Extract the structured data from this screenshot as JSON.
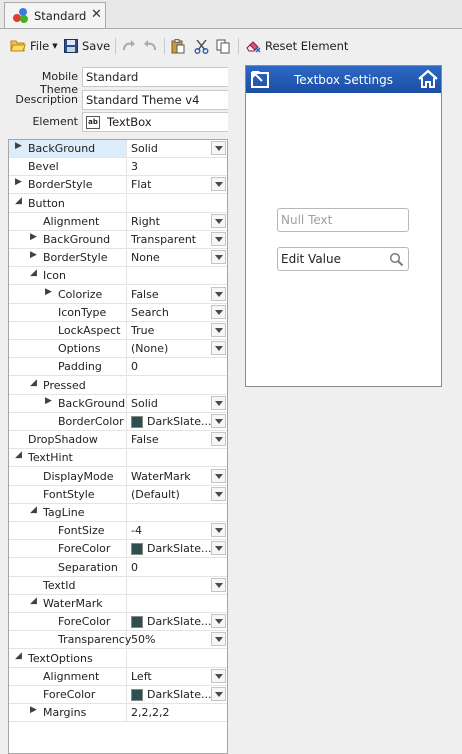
{
  "tab": {
    "title": "Standard",
    "close": "✕"
  },
  "toolbar": {
    "file_label": "File",
    "save_label": "Save",
    "reset_label": "Reset Element"
  },
  "form": {
    "theme_label": "Mobile Theme",
    "theme_value": "Standard",
    "desc_label": "Description",
    "desc_value": "Standard Theme v4",
    "element_label": "Element",
    "element_value": "TextBox",
    "element_icon_text": "ab"
  },
  "grid": {
    "rows": [
      {
        "n": "BackGround",
        "v": "Solid",
        "lv": 0,
        "e": "c",
        "dd": true
      },
      {
        "n": "Bevel",
        "v": "3",
        "lv": 0,
        "e": ""
      },
      {
        "n": "BorderStyle",
        "v": "Flat",
        "lv": 0,
        "e": "c",
        "dd": true
      },
      {
        "n": "Button",
        "v": "",
        "lv": 0,
        "e": "o"
      },
      {
        "n": "Alignment",
        "v": "Right",
        "lv": 1,
        "e": "",
        "dd": true
      },
      {
        "n": "BackGround",
        "v": "Transparent",
        "lv": 1,
        "e": "c",
        "dd": true
      },
      {
        "n": "BorderStyle",
        "v": "None",
        "lv": 1,
        "e": "c",
        "dd": true
      },
      {
        "n": "Icon",
        "v": "",
        "lv": 1,
        "e": "o"
      },
      {
        "n": "Colorize",
        "v": "False",
        "lv": 2,
        "e": "c",
        "dd": true
      },
      {
        "n": "IconType",
        "v": "Search",
        "lv": 2,
        "e": "",
        "dd": true
      },
      {
        "n": "LockAspect",
        "v": "True",
        "lv": 2,
        "e": "",
        "dd": true
      },
      {
        "n": "Options",
        "v": "(None)",
        "lv": 2,
        "e": "",
        "dd": true
      },
      {
        "n": "Padding",
        "v": "0",
        "lv": 2,
        "e": ""
      },
      {
        "n": "Pressed",
        "v": "",
        "lv": 1,
        "e": "o"
      },
      {
        "n": "BackGround",
        "v": "Solid",
        "lv": 2,
        "e": "c",
        "dd": true
      },
      {
        "n": "BorderColor",
        "v": "DarkSlate...",
        "lv": 2,
        "e": "",
        "dd": true,
        "sw": true
      },
      {
        "n": "DropShadow",
        "v": "False",
        "lv": 0,
        "e": "",
        "dd": true
      },
      {
        "n": "TextHint",
        "v": "",
        "lv": 0,
        "e": "o"
      },
      {
        "n": "DisplayMode",
        "v": "WaterMark",
        "lv": 1,
        "e": "",
        "dd": true
      },
      {
        "n": "FontStyle",
        "v": "(Default)",
        "lv": 1,
        "e": "",
        "dd": true
      },
      {
        "n": "TagLine",
        "v": "",
        "lv": 1,
        "e": "o"
      },
      {
        "n": "FontSize",
        "v": "-4",
        "lv": 2,
        "e": "",
        "dd": true
      },
      {
        "n": "ForeColor",
        "v": "DarkSlate...",
        "lv": 2,
        "e": "",
        "dd": true,
        "sw": true
      },
      {
        "n": "Separation",
        "v": "0",
        "lv": 2,
        "e": ""
      },
      {
        "n": "TextId",
        "v": "",
        "lv": 1,
        "e": "",
        "dd": true
      },
      {
        "n": "WaterMark",
        "v": "",
        "lv": 1,
        "e": "o"
      },
      {
        "n": "ForeColor",
        "v": "DarkSlate...",
        "lv": 2,
        "e": "",
        "dd": true,
        "sw": true
      },
      {
        "n": "Transparency",
        "v": "50%",
        "lv": 2,
        "e": "",
        "dd": true
      },
      {
        "n": "TextOptions",
        "v": "",
        "lv": 0,
        "e": "o"
      },
      {
        "n": "Alignment",
        "v": "Left",
        "lv": 1,
        "e": "",
        "dd": true
      },
      {
        "n": "ForeColor",
        "v": "DarkSlate...",
        "lv": 1,
        "e": "",
        "dd": true,
        "sw": true
      },
      {
        "n": "Margins",
        "v": "2,2,2,2",
        "lv": 1,
        "e": "c"
      }
    ]
  },
  "preview": {
    "title": "Textbox Settings",
    "null_text": "Null Text",
    "edit_value": "Edit Value"
  },
  "colors": {
    "header_blue": "#2460bd",
    "swatch_darkslate": "#2f4f4f",
    "selected_row": "#dcecfb"
  }
}
